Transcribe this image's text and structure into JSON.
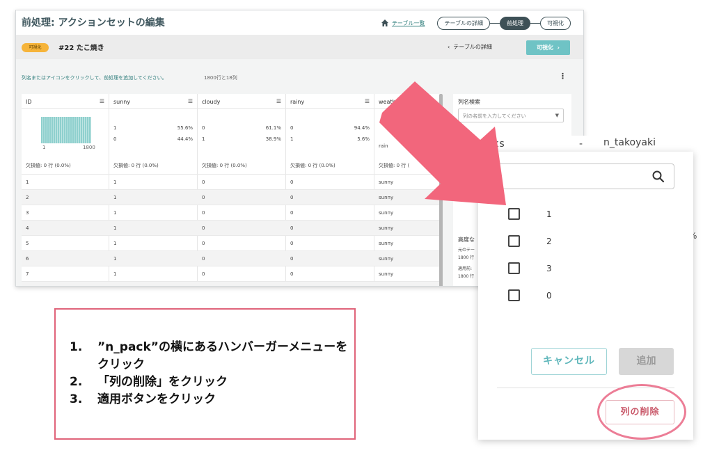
{
  "app": {
    "page_title": "前処理: アクションセットの編集",
    "nav": {
      "table_list_link": "テーブル一覧",
      "steps": [
        "テーブルの詳細",
        "前処理",
        "可視化"
      ],
      "active_step": 1
    },
    "subheader": {
      "badge": "可視化",
      "title": "#22 たこ焼き",
      "back_link": "テーブルの詳細",
      "visualize_button": "可視化"
    },
    "hint": "列名またはアイコンをクリックして、前処理を追加してください。",
    "row_count": "1800行と18列",
    "table": {
      "columns": [
        {
          "name": "ID",
          "stats": [],
          "hist_min": "1",
          "hist_max": "1800",
          "missing": "欠損値: 0 行 (0.0%)"
        },
        {
          "name": "sunny",
          "stats": [
            [
              "1",
              "55.6%"
            ],
            [
              "0",
              "44.4%"
            ]
          ],
          "missing": "欠損値: 0 行 (0.0%)"
        },
        {
          "name": "cloudy",
          "stats": [
            [
              "0",
              "61.1%"
            ],
            [
              "1",
              "38.9%"
            ]
          ],
          "missing": "欠損値: 0 行 (0.0%)"
        },
        {
          "name": "rainy",
          "stats": [
            [
              "0",
              "94.4%"
            ],
            [
              "1",
              "5.6%"
            ]
          ],
          "missing": "欠損値: 0 行 (0.0%)"
        },
        {
          "name": "weather",
          "stats": [
            [
              "rain",
              ""
            ]
          ],
          "missing": "欠損値: 0 行 ("
        }
      ],
      "rows": [
        [
          "1",
          "1",
          "0",
          "0",
          "sunny"
        ],
        [
          "2",
          "1",
          "0",
          "0",
          "sunny"
        ],
        [
          "3",
          "1",
          "0",
          "0",
          "sunny"
        ],
        [
          "4",
          "1",
          "0",
          "0",
          "sunny"
        ],
        [
          "5",
          "1",
          "0",
          "0",
          "sunny"
        ],
        [
          "6",
          "1",
          "0",
          "0",
          "sunny"
        ],
        [
          "7",
          "1",
          "0",
          "0",
          "sunny"
        ],
        [
          "8",
          "1",
          "0",
          "0",
          "sunny"
        ]
      ]
    },
    "side_panel": {
      "label": "列名検索",
      "select_placeholder": "列の名前を入力してください",
      "advanced": "高度な",
      "lines": [
        "元のテー",
        "1800 行",
        "適用前:",
        "1800 行"
      ]
    }
  },
  "popup": {
    "behind_left": "acks",
    "behind_dash": "-",
    "behind_right": "n_takoyaki",
    "search_placeholder": "",
    "options": [
      "1",
      "2",
      "3",
      "0"
    ],
    "cancel_button": "キャンセル",
    "add_button": "追加",
    "delete_column_button": "列の削除",
    "right_edge_text": "%"
  },
  "instructions": {
    "items": [
      {
        "num": "1.",
        "text": "”n_pack”の横にあるハンバーガーメニューをクリック"
      },
      {
        "num": "2.",
        "text": "「列の削除」をクリック"
      },
      {
        "num": "3.",
        "text": "適用ボタンをクリック"
      }
    ]
  },
  "colors": {
    "teal": "#6fc3c5",
    "arrow": "#f2667c",
    "highlight_ring": "#ec7d96",
    "badge": "#f6b43a"
  }
}
